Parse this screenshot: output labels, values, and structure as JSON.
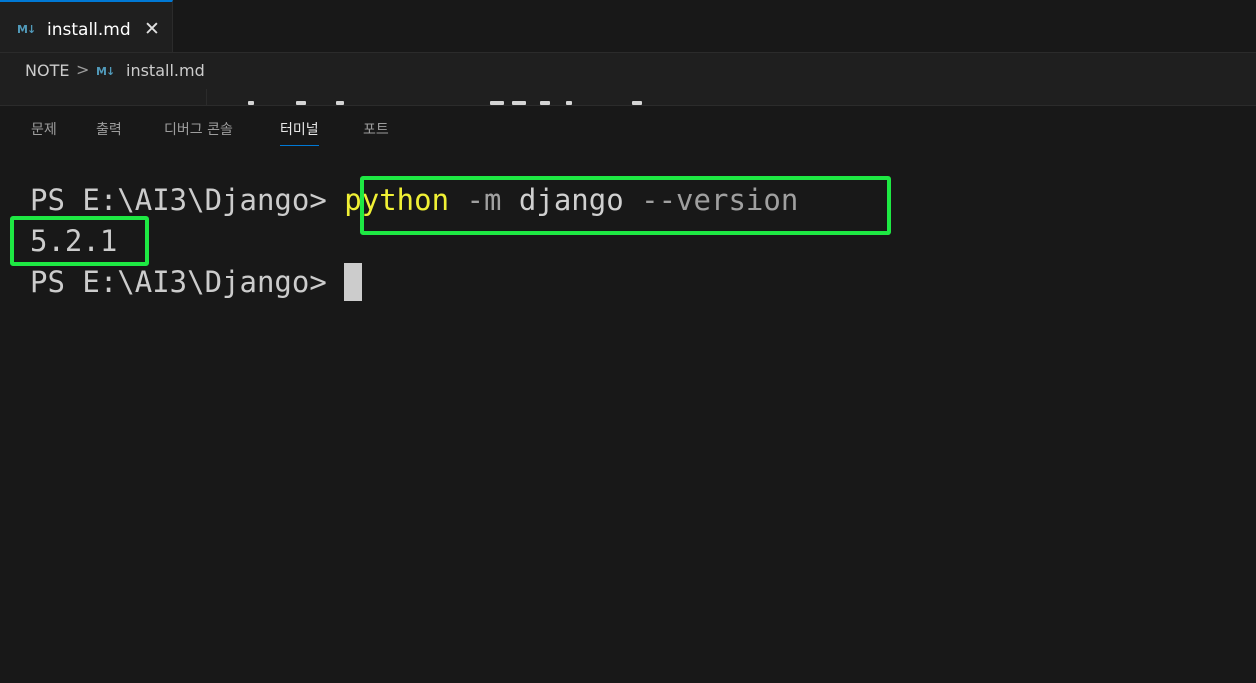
{
  "editor": {
    "tab": {
      "icon": "markdown-icon",
      "label": "install.md",
      "close": "✕"
    },
    "breadcrumb": {
      "folder": "NOTE",
      "separator": ">",
      "icon": "markdown-icon",
      "file": "install.md"
    }
  },
  "panel": {
    "tabs": [
      {
        "label": "문제",
        "active": false
      },
      {
        "label": "출력",
        "active": false
      },
      {
        "label": "디버그 콘솔",
        "active": false
      },
      {
        "label": "터미널",
        "active": true
      },
      {
        "label": "포트",
        "active": false
      }
    ]
  },
  "terminal": {
    "prompt": "PS E:\\AI3\\Django>",
    "command": {
      "program": "python",
      "flag": "-m",
      "module": "django",
      "option": "--version"
    },
    "output": "5.2.1",
    "prompt2": "PS E:\\AI3\\Django>"
  },
  "colors": {
    "background": "#181818",
    "accent": "#0078d4",
    "highlight": "#1ee843",
    "command_yellow": "#f0f035",
    "markdown_icon": "#519aba"
  }
}
